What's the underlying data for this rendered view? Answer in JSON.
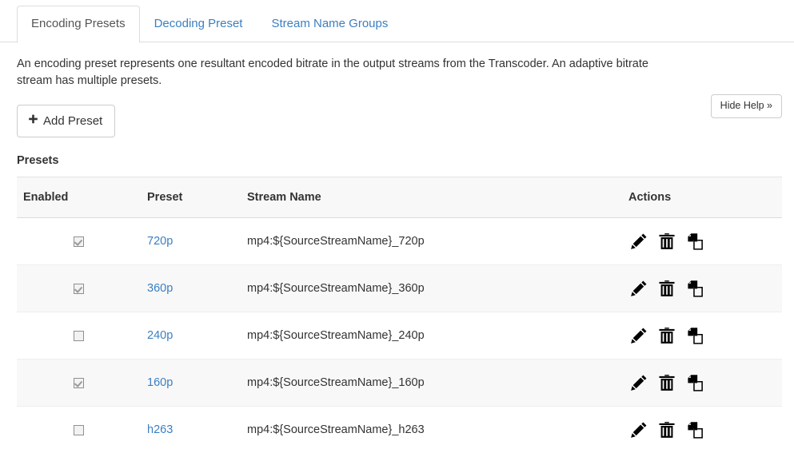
{
  "tabs": [
    {
      "label": "Encoding Presets",
      "active": true
    },
    {
      "label": "Decoding Preset",
      "active": false
    },
    {
      "label": "Stream Name Groups",
      "active": false
    }
  ],
  "help": {
    "text": "An encoding preset represents one resultant encoded bitrate in the output streams from the Transcoder. An adaptive bitrate stream has multiple presets.",
    "hide_button_label": "Hide Help »"
  },
  "toolbar": {
    "add_preset_label": "Add Preset",
    "add_preset_icon": "plus-icon",
    "plus_glyph": "✚"
  },
  "section": {
    "heading": "Presets"
  },
  "table": {
    "columns": [
      "Enabled",
      "Preset",
      "Stream Name",
      "Actions"
    ],
    "rows": [
      {
        "enabled": true,
        "preset": "720p",
        "stream_name": "mp4:${SourceStreamName}_720p"
      },
      {
        "enabled": true,
        "preset": "360p",
        "stream_name": "mp4:${SourceStreamName}_360p"
      },
      {
        "enabled": false,
        "preset": "240p",
        "stream_name": "mp4:${SourceStreamName}_240p"
      },
      {
        "enabled": true,
        "preset": "160p",
        "stream_name": "mp4:${SourceStreamName}_160p"
      },
      {
        "enabled": false,
        "preset": "h263",
        "stream_name": "mp4:${SourceStreamName}_h263"
      }
    ],
    "action_icons": [
      "edit-pencil-icon",
      "delete-trash-icon",
      "duplicate-copy-icon"
    ]
  },
  "colors": {
    "link_blue": "#3a7fc1",
    "text": "#333333",
    "border": "#dddddd",
    "stripe": "#f8f8f8"
  }
}
